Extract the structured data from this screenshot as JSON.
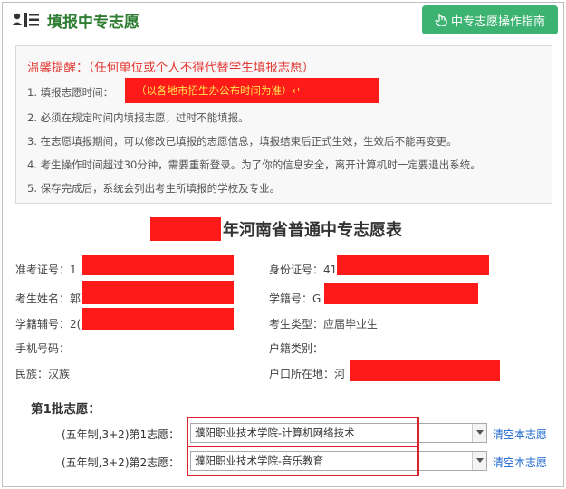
{
  "header": {
    "title": "填报中专志愿",
    "guide_button": "中专志愿操作指南"
  },
  "notice": {
    "title": "温馨提醒：（任何单位或个人不得代替学生填报志愿）",
    "items": [
      "1. 填报志愿时间：",
      "2. 必须在规定时间内填报志愿，过时不能填报。",
      "3. 在志愿填报期间，可以修改已填报的志愿信息，填报结束后正式生效，生效后不能再变更。",
      "4. 考生操作时间超过30分钟，需要重新登录。为了你的信息安全，离开计算机时一定要退出系统。",
      "5. 保存完成后，系统会列出考生所填报的学校及专业。"
    ],
    "time_note": "（以各地市招生办公布时间为准）↵"
  },
  "form": {
    "title_suffix": "年河南省普通中专志愿表",
    "left": [
      {
        "label": "准考证号：1"
      },
      {
        "label": "考生姓名：郭"
      },
      {
        "label": "学籍辅号：2("
      },
      {
        "label": "手机号码："
      },
      {
        "label": "民族：汉族"
      }
    ],
    "right": [
      {
        "label": "身份证号：41"
      },
      {
        "label": "学籍号：G"
      },
      {
        "label": "考生类型：应届毕业生"
      },
      {
        "label": "户籍类别："
      },
      {
        "label": "户口所在地：河"
      }
    ]
  },
  "choices": {
    "batch_label": "第1批志愿：",
    "rows": [
      {
        "label": "(五年制,3+2)第1志愿：",
        "value": "濮阳职业技术学院-计算机网络技术",
        "clear": "清空本志愿"
      },
      {
        "label": "(五年制,3+2)第2志愿：",
        "value": "濮阳职业技术学院-音乐教育",
        "clear": "清空本志愿"
      }
    ]
  },
  "colors": {
    "accent_green": "#3cb371",
    "title_green": "#2e7d32",
    "warning_red": "#e53935",
    "redaction": "#ff1a1a",
    "link_blue": "#1a66cc"
  }
}
